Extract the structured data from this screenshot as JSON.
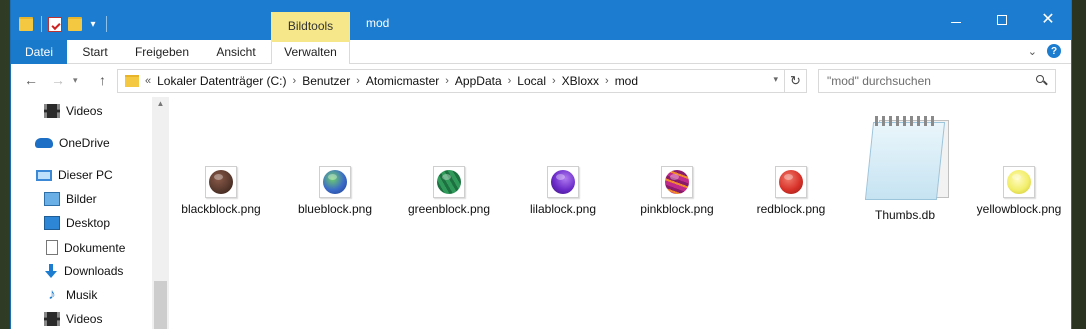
{
  "window": {
    "title": "mod",
    "contextual_tab_header": "Bildtools"
  },
  "ribbon": {
    "tabs": [
      "Datei",
      "Start",
      "Freigeben",
      "Ansicht",
      "Verwalten"
    ]
  },
  "address": {
    "overflow": "«",
    "crumbs": [
      "Lokaler Datenträger (C:)",
      "Benutzer",
      "Atomicmaster",
      "AppData",
      "Local",
      "XBloxx",
      "mod"
    ],
    "separator": "›"
  },
  "search": {
    "placeholder": "\"mod\" durchsuchen"
  },
  "navpane": {
    "items": [
      {
        "label": "Videos",
        "icon": "video-icon"
      },
      {
        "label": "OneDrive",
        "icon": "onedrive-icon"
      },
      {
        "label": "Dieser PC",
        "icon": "computer-icon"
      },
      {
        "label": "Bilder",
        "icon": "pictures-icon"
      },
      {
        "label": "Desktop",
        "icon": "desktop-icon"
      },
      {
        "label": "Dokumente",
        "icon": "documents-icon"
      },
      {
        "label": "Downloads",
        "icon": "downloads-icon"
      },
      {
        "label": "Musik",
        "icon": "music-icon"
      },
      {
        "label": "Videos",
        "icon": "video-icon"
      }
    ]
  },
  "files": [
    {
      "name": "blackblock.png",
      "color": "#5a3a2e"
    },
    {
      "name": "blueblock.png",
      "color": "#3a6ac8"
    },
    {
      "name": "greenblock.png",
      "color": "#2f9a5a"
    },
    {
      "name": "lilablock.png",
      "color": "#6a2ac8"
    },
    {
      "name": "pinkblock.png",
      "color": "#c02a8a"
    },
    {
      "name": "redblock.png",
      "color": "#d8322a"
    },
    {
      "name": "Thumbs.db",
      "color": "#c6e3f2"
    },
    {
      "name": "yellowblock.png",
      "color": "#f2ee6a"
    }
  ]
}
